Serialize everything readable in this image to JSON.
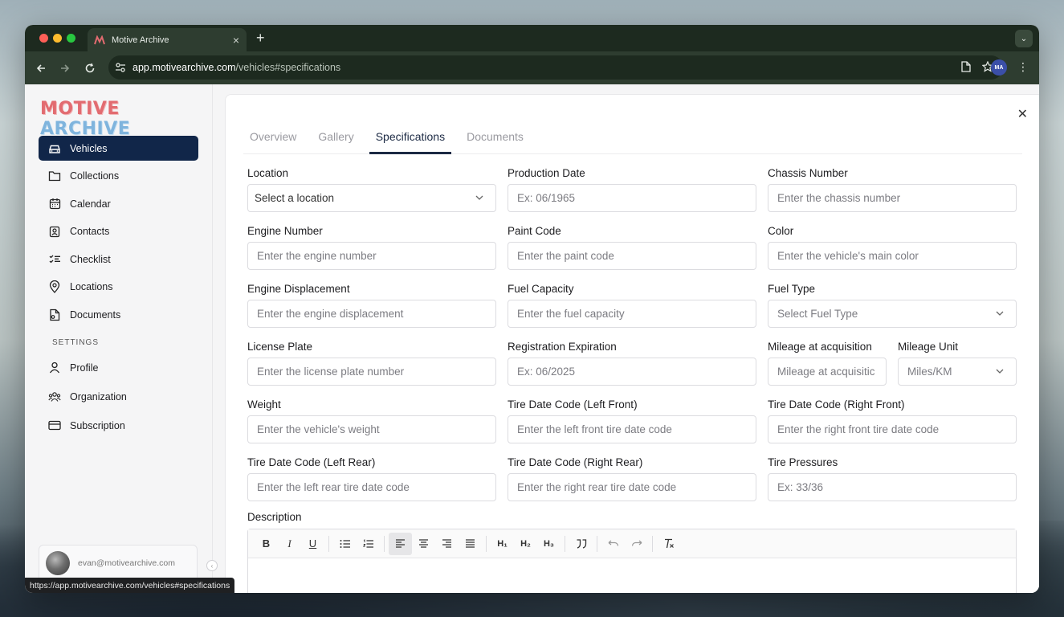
{
  "browser": {
    "tab_title": "Motive Archive",
    "url_host": "app.motivearchive.com",
    "url_path": "/vehicles#specifications",
    "status_url": "https://app.motivearchive.com/vehicles#specifications"
  },
  "logo": {
    "part1": "MOTIVE",
    "part2": "ARCHIVE"
  },
  "sidebar": {
    "items": [
      {
        "label": "Vehicles",
        "icon": "car-icon",
        "active": true
      },
      {
        "label": "Collections",
        "icon": "folder-icon"
      },
      {
        "label": "Calendar",
        "icon": "calendar-icon"
      },
      {
        "label": "Contacts",
        "icon": "contact-icon"
      },
      {
        "label": "Checklist",
        "icon": "checklist-icon"
      },
      {
        "label": "Locations",
        "icon": "map-pin-icon"
      },
      {
        "label": "Documents",
        "icon": "document-icon"
      }
    ],
    "settings_label": "SETTINGS",
    "settings_items": [
      {
        "label": "Profile",
        "icon": "user-icon"
      },
      {
        "label": "Organization",
        "icon": "users-icon"
      },
      {
        "label": "Subscription",
        "icon": "credit-card-icon"
      }
    ],
    "user_email": "evan@motivearchive.com"
  },
  "tabs": [
    "Overview",
    "Gallery",
    "Specifications",
    "Documents"
  ],
  "active_tab": "Specifications",
  "fields": [
    {
      "label": "Location",
      "placeholder": "Select a location",
      "select": true
    },
    {
      "label": "Production Date",
      "placeholder": "Ex: 06/1965"
    },
    {
      "label": "Chassis Number",
      "placeholder": "Enter the chassis number"
    },
    {
      "label": "Engine Number",
      "placeholder": "Enter the engine number"
    },
    {
      "label": "Paint Code",
      "placeholder": "Enter the paint code"
    },
    {
      "label": "Color",
      "placeholder": "Enter the vehicle's main color"
    },
    {
      "label": "Engine Displacement",
      "placeholder": "Enter the engine displacement"
    },
    {
      "label": "Fuel Capacity",
      "placeholder": "Enter the fuel capacity"
    },
    {
      "label": "Fuel Type",
      "placeholder": "Select Fuel Type",
      "select": true
    },
    {
      "label": "License Plate",
      "placeholder": "Enter the license plate number"
    },
    {
      "label": "Registration Expiration",
      "placeholder": "Ex: 06/2025"
    },
    {
      "label": "Mileage at acquisition",
      "placeholder": "Mileage at acquisitic"
    },
    {
      "label": "Mileage Unit",
      "placeholder": "Miles/KM",
      "select": true
    },
    {
      "label": "Weight",
      "placeholder": "Enter the vehicle's weight"
    },
    {
      "label": "Tire Date Code (Left Front)",
      "placeholder": "Enter the left front tire date code"
    },
    {
      "label": "Tire Date Code (Right Front)",
      "placeholder": "Enter the right front tire date code"
    },
    {
      "label": "Tire Date Code (Left Rear)",
      "placeholder": "Enter the left rear tire date code"
    },
    {
      "label": "Tire Date Code (Right Rear)",
      "placeholder": "Enter the right rear tire date code"
    },
    {
      "label": "Tire Pressures",
      "placeholder": "Ex: 33/36"
    }
  ],
  "description_label": "Description",
  "editor_toolbar": {
    "bold": "B",
    "italic": "I",
    "underline": "U",
    "h1": "H₁",
    "h2": "H₂",
    "h3": "H₃"
  }
}
